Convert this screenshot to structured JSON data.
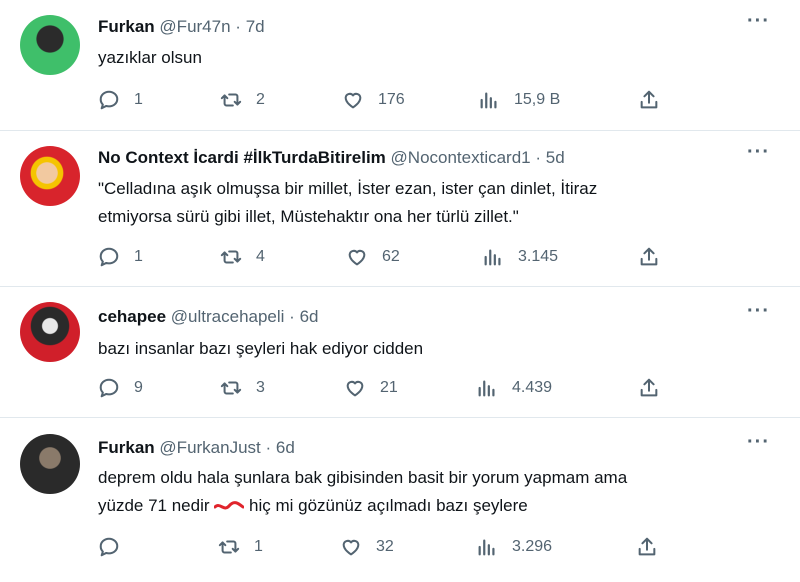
{
  "tweets": [
    {
      "name": "Furkan",
      "handle": "@Fur47n",
      "dot": "·",
      "time": "7d",
      "text_lines": [
        "yazıklar olsun"
      ],
      "replies": "1",
      "retweets": "2",
      "likes": "176",
      "views": "15,9 B",
      "avatar_colors": [
        "#3fbf6a",
        "#1f6e3a"
      ]
    },
    {
      "name": "No Context İcardi #İlkTurdaBitirelim",
      "handle": "@Nocontexticard1",
      "dot": "·",
      "time": "5d",
      "text_lines": [
        "\"Celladına aşık olmuşsa bir millet, İster ezan, ister çan dinlet, İtiraz",
        "etmiyorsa sürü gibi illet, Müstehaktır ona her türlü zillet.\""
      ],
      "replies": "1",
      "retweets": "4",
      "likes": "62",
      "views": "3.145",
      "avatar_colors": [
        "#d8242c",
        "#f5c400"
      ]
    },
    {
      "name": "cehapee",
      "handle": "@ultracehapeli",
      "dot": "·",
      "time": "6d",
      "text_lines": [
        "bazı insanlar bazı şeyleri hak ediyor cidden"
      ],
      "replies": "9",
      "retweets": "3",
      "likes": "21",
      "views": "4.439",
      "avatar_colors": [
        "#d01f2a",
        "#2a2a2a"
      ]
    },
    {
      "name": "Furkan",
      "handle": "@FurkanJust",
      "dot": "·",
      "time": "6d",
      "text_line1": "deprem oldu hala şunlara bak gibisinden basit bir yorum yapmam ama",
      "text_line2_a": "yüzde 71 nedir",
      "text_line2_b": "hiç mi gözünüz açılmadı bazı şeylere",
      "replies": "",
      "retweets": "1",
      "likes": "32",
      "views": "3.296",
      "avatar_colors": [
        "#3a3a3a",
        "#111111"
      ]
    }
  ],
  "more_glyph": "···",
  "icons": [
    "reply-icon",
    "retweet-icon",
    "like-icon",
    "views-icon",
    "share-icon",
    "more-icon"
  ],
  "colors": {
    "text": "#0f1419",
    "muted": "#536471",
    "divider": "#e1e8ed",
    "red_mark": "#e0242c"
  }
}
